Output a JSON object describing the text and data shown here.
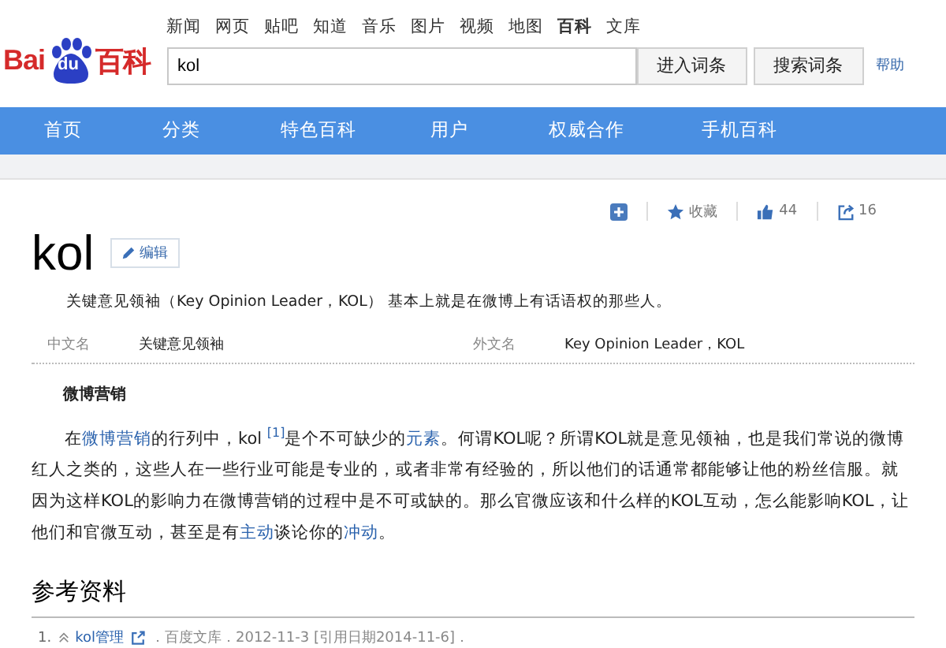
{
  "nav_links": [
    {
      "label": "新闻",
      "selected": false
    },
    {
      "label": "网页",
      "selected": false
    },
    {
      "label": "贴吧",
      "selected": false
    },
    {
      "label": "知道",
      "selected": false
    },
    {
      "label": "音乐",
      "selected": false
    },
    {
      "label": "图片",
      "selected": false
    },
    {
      "label": "视频",
      "selected": false
    },
    {
      "label": "地图",
      "selected": false
    },
    {
      "label": "百科",
      "selected": true
    },
    {
      "label": "文库",
      "selected": false
    }
  ],
  "logo": {
    "text_1": "Bai",
    "text_2": "du",
    "text_3": "百科"
  },
  "search": {
    "value": "kol"
  },
  "buttons": [
    "进入词条",
    "搜索词条"
  ],
  "help_link": "帮助",
  "menu": [
    "首页",
    "分类",
    "特色百科",
    "用户",
    "权威合作",
    "手机百科"
  ],
  "actions": [
    {
      "kind": "add"
    },
    {
      "kind": "favorite",
      "label": "收藏"
    },
    {
      "kind": "like",
      "label": "44"
    },
    {
      "kind": "share",
      "label": "16"
    }
  ],
  "title": "kol",
  "edit_button": "编辑",
  "summary": "关键意见领袖（Key Opinion Leader，KOL） 基本上就是在微博上有话语权的那些人。",
  "info": [
    {
      "label": "中文名",
      "value": "关键意见领袖"
    },
    {
      "label": "外文名",
      "value": "Key Opinion Leader，KOL"
    }
  ],
  "section": {
    "heading": "微博营销",
    "segments": [
      {
        "kind": "text",
        "text": "在"
      },
      {
        "kind": "link",
        "text": "微博营销"
      },
      {
        "kind": "text",
        "text": "的行列中，kol "
      },
      {
        "kind": "sup",
        "text": "[1]"
      },
      {
        "kind": "text",
        "text": "是个不可缺少的"
      },
      {
        "kind": "link",
        "text": "元素"
      },
      {
        "kind": "text",
        "text": "。何谓KOL呢？所谓KOL就是意见领袖，也是我们常说的微博红人之类的，这些人在一些行业可能是专业的，或者非常有经验的，所以他们的话通常都能够让他的粉丝信服。就因为这样KOL的影响力在微博营销的过程中是不可或缺的。那么官微应该和什么样的KOL互动，怎么能影响KOL，让他们和官微互动，甚至是有"
      },
      {
        "kind": "link",
        "text": "主动"
      },
      {
        "kind": "text",
        "text": "谈论你的"
      },
      {
        "kind": "link",
        "text": "冲动"
      },
      {
        "kind": "text",
        "text": "。"
      }
    ]
  },
  "references": {
    "heading": "参考资料",
    "items": [
      {
        "number": "1.",
        "title": "kol管理",
        "source": "．百度文库．2012-11-3 [引用日期2014-11-6]．"
      }
    ]
  }
}
